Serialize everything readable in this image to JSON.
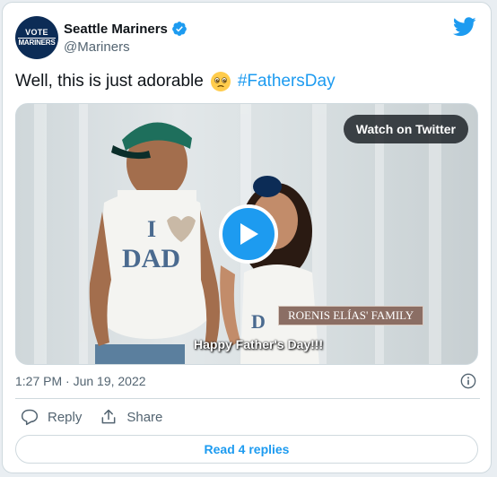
{
  "author": {
    "avatar_line1": "VOTE",
    "avatar_line2": "MARINERS",
    "name": "Seattle Mariners",
    "handle": "@Mariners",
    "verified": true
  },
  "tweet": {
    "text": "Well, this is just adorable",
    "emoji": "pleading-face-emoji",
    "hashtag": "#FathersDay"
  },
  "media": {
    "watch_label": "Watch on Twitter",
    "caption_tag": "ROENIS ELÍAS' FAMILY",
    "subtitle": "Happy Father's Day!!!"
  },
  "meta": {
    "timestamp": "1:27 PM · Jun 19, 2022"
  },
  "actions": {
    "reply_label": "Reply",
    "share_label": "Share",
    "read_replies_label": "Read 4 replies"
  },
  "colors": {
    "accent": "#1d9bf0",
    "text": "#0f1419",
    "muted": "#536471",
    "border": "#cfd9de"
  }
}
